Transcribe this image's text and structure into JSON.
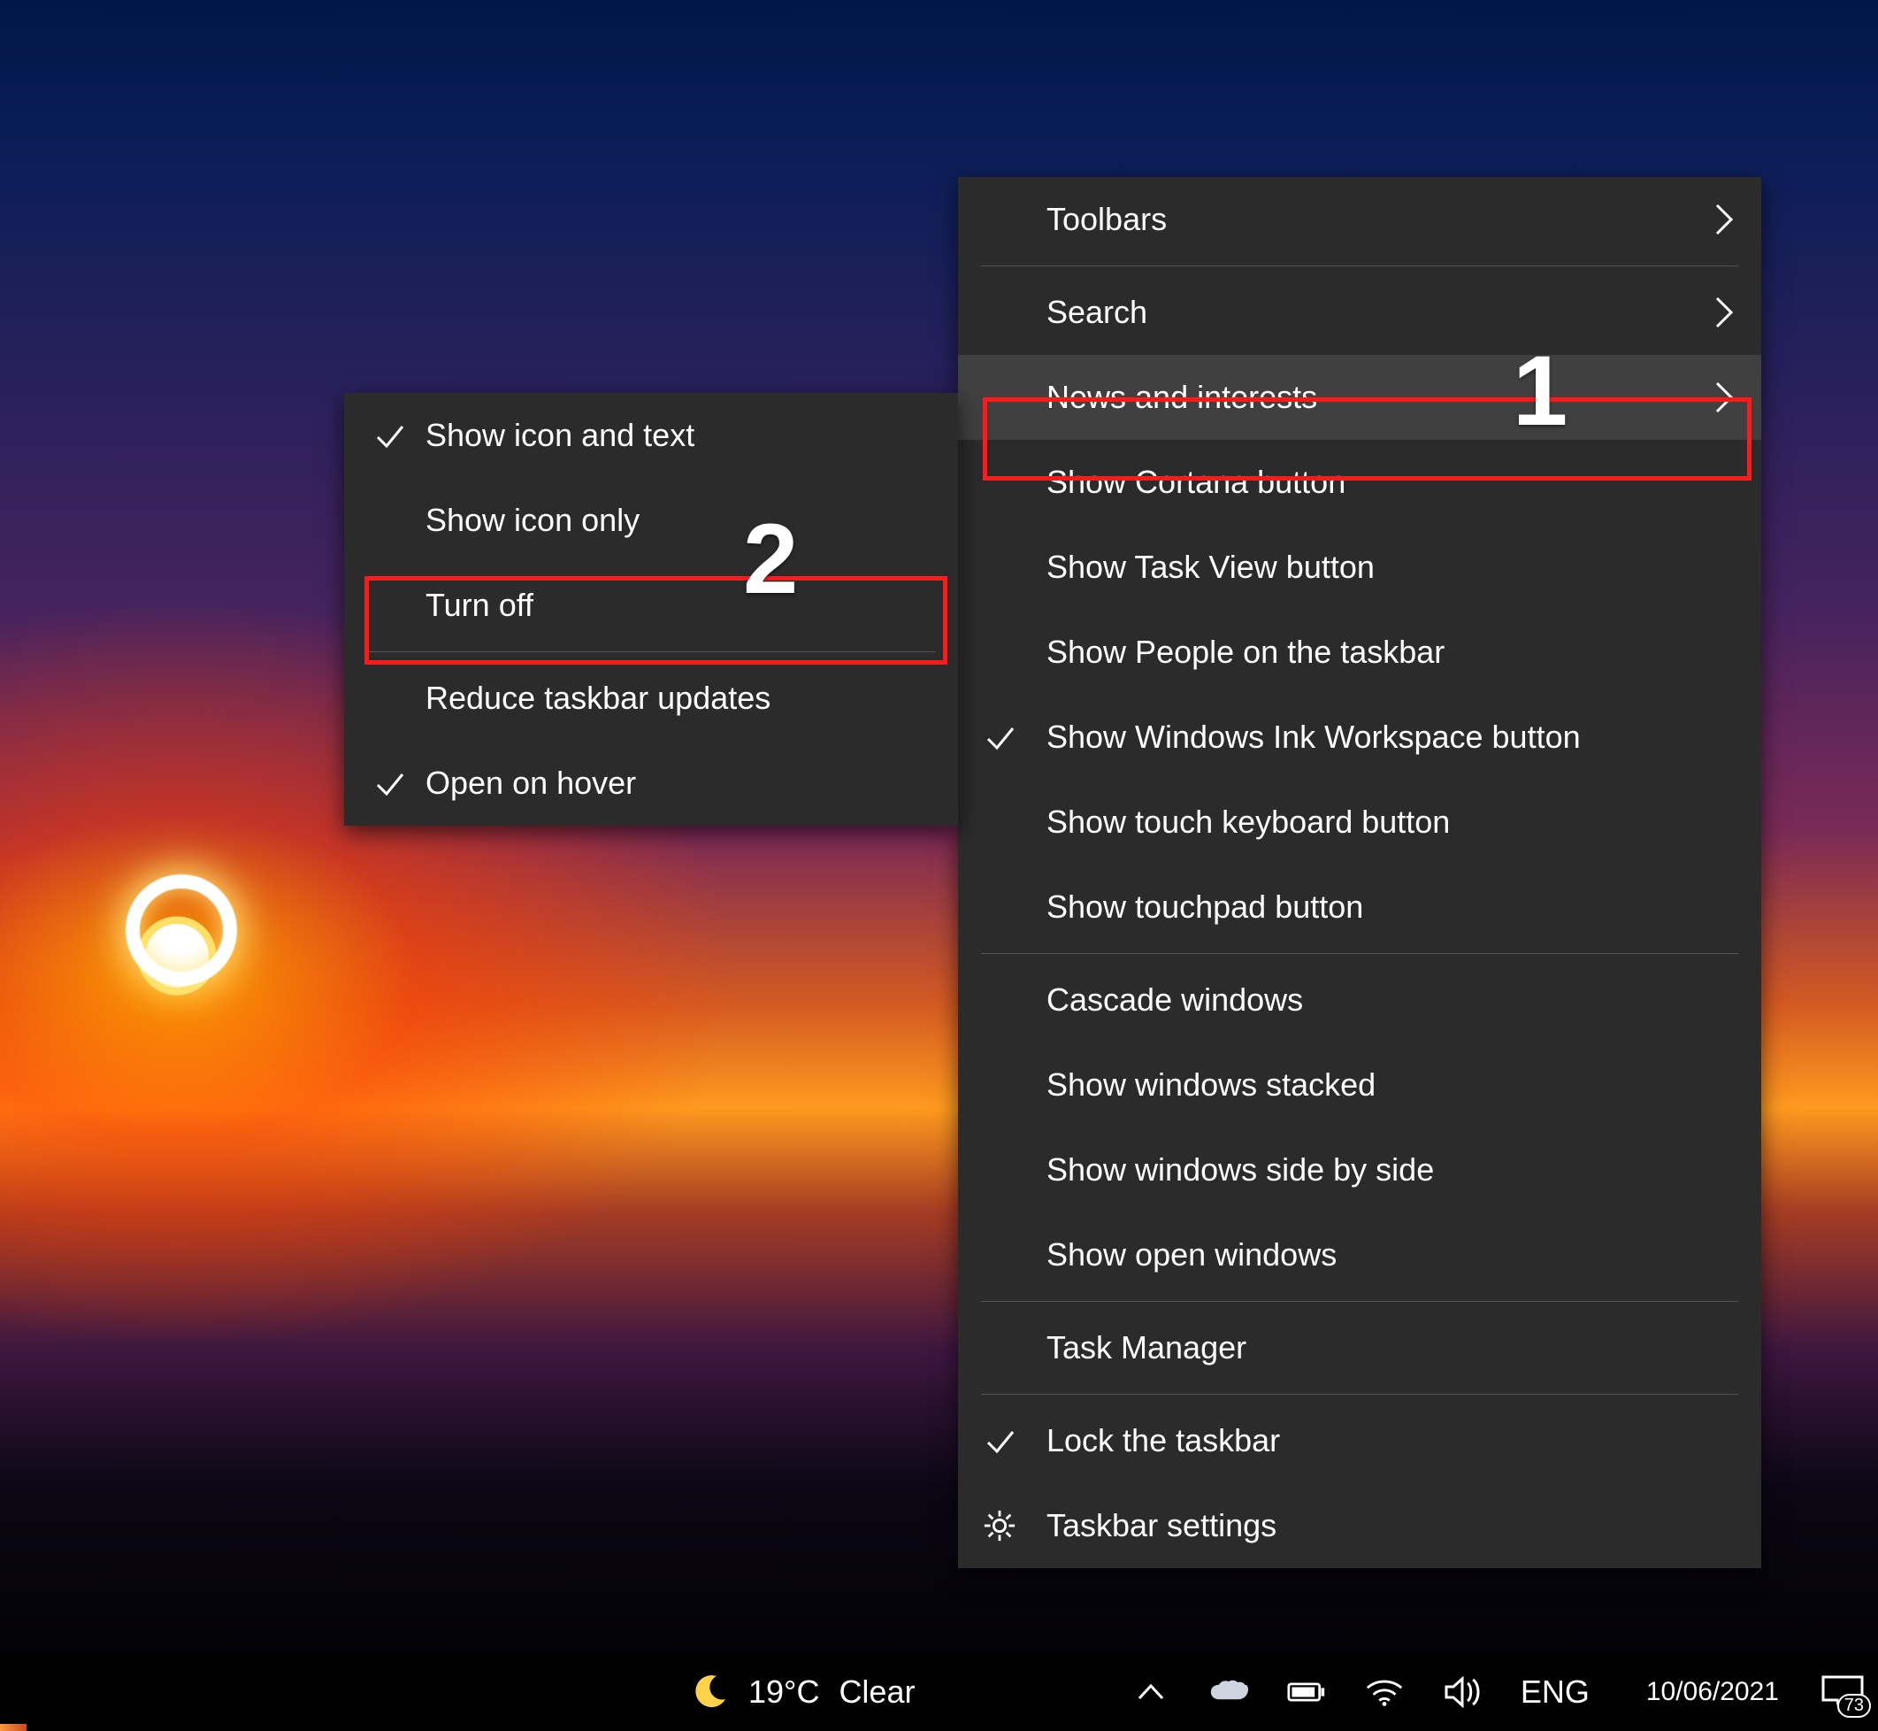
{
  "annotations": {
    "numbers": {
      "one": "1",
      "two": "2"
    }
  },
  "main_menu": {
    "toolbars": "Toolbars",
    "search": "Search",
    "news": "News and interests",
    "cortana": "Show Cortana button",
    "taskview": "Show Task View button",
    "people": "Show People on the taskbar",
    "ink": "Show Windows Ink Workspace button",
    "touchkb": "Show touch keyboard button",
    "touchpad": "Show touchpad button",
    "cascade": "Cascade windows",
    "stacked": "Show windows stacked",
    "sidebyside": "Show windows side by side",
    "showopen": "Show open windows",
    "taskmgr": "Task Manager",
    "lock": "Lock the taskbar",
    "settings": "Taskbar settings"
  },
  "sub_menu": {
    "icon_text": "Show icon and text",
    "icon_only": "Show icon only",
    "turn_off": "Turn off",
    "reduce": "Reduce taskbar updates",
    "hover": "Open on hover"
  },
  "taskbar": {
    "temp": "19°C",
    "cond": "Clear",
    "lang": "ENG",
    "date": "10/06/2021",
    "notif_count": "73"
  }
}
